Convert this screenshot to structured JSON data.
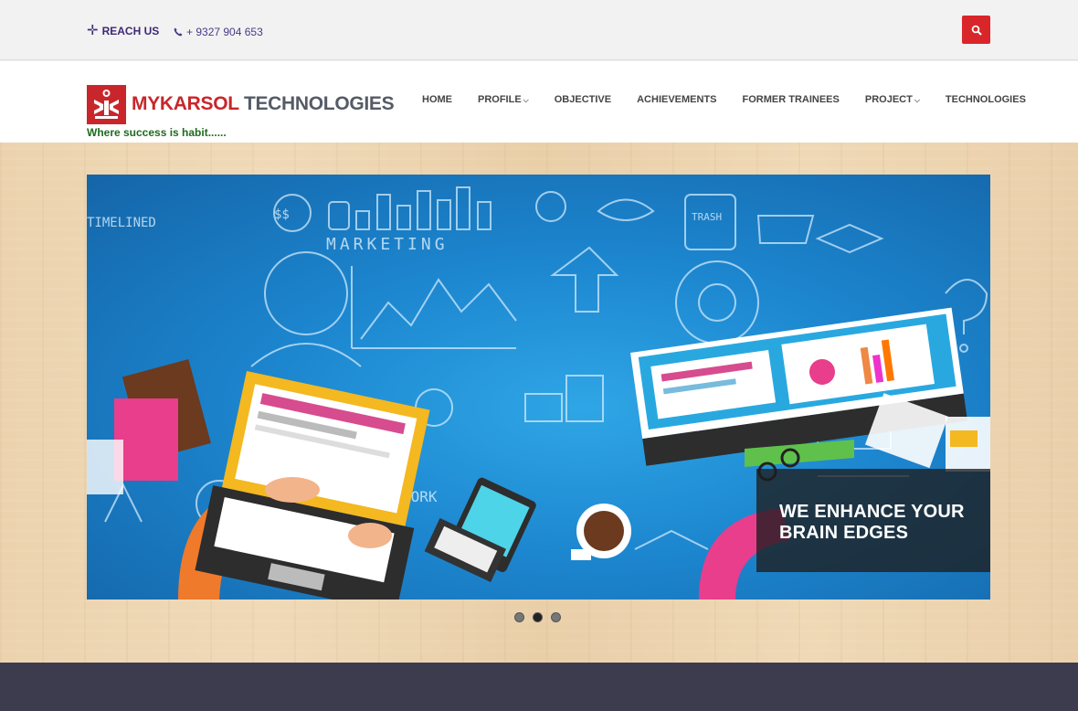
{
  "topbar": {
    "reach_label": "REACH US",
    "phone": "+ 9327 904 653",
    "search_icon": "search-icon"
  },
  "header": {
    "brand_part1": "MYKARSOL",
    "brand_part2": "TECHNOLOGIES",
    "tagline": "Where success is habit......",
    "nav": [
      {
        "label": "HOME",
        "has_dropdown": false
      },
      {
        "label": "PROFILE",
        "has_dropdown": true
      },
      {
        "label": "OBJECTIVE",
        "has_dropdown": false
      },
      {
        "label": "ACHIEVEMENTS",
        "has_dropdown": false
      },
      {
        "label": "FORMER TRAINEES",
        "has_dropdown": false
      },
      {
        "label": "PROJECT",
        "has_dropdown": true
      },
      {
        "label": "TECHNOLOGIES",
        "has_dropdown": false
      }
    ]
  },
  "slider": {
    "caption_line1": "WE ENHANCE YOUR",
    "caption_line2": "BRAIN EDGES",
    "doodle_labels": [
      "TIMELINED",
      "MARKETING",
      "$$",
      "TRASH",
      "WORK"
    ],
    "slide_count": 3,
    "active_slide": 2
  },
  "colors": {
    "accent": "#d9262b",
    "brand_red": "#c9262b",
    "brand_gray": "#555b66",
    "tagline_green": "#1e6b1e",
    "footer_band": "#3d3c4f"
  }
}
